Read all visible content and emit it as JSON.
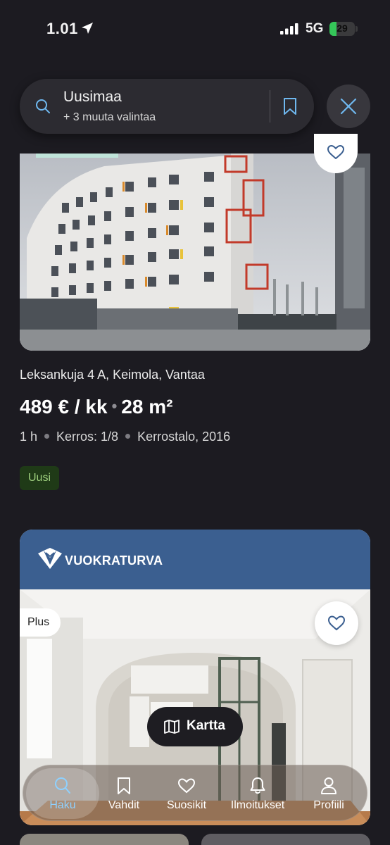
{
  "status_bar": {
    "time": "1.01",
    "network": "5G",
    "battery_level": "29",
    "battery_fraction": 0.29
  },
  "search": {
    "title": "Uusimaa",
    "subtitle": "+ 3 muuta valintaa"
  },
  "listing1": {
    "address": "Leksankuja 4 A, Keimola, Vantaa",
    "price": "489 € / kk",
    "area": "28  m²",
    "details": [
      "1 h",
      "Kerros: 1/8",
      "Kerrostalo, 2016"
    ],
    "badge": "Uusi"
  },
  "listing2": {
    "brand": "VUOKRATURVA",
    "badge": "Plus"
  },
  "map_button": {
    "label": "Kartta"
  },
  "nav": {
    "items": [
      {
        "label": "Haku",
        "icon": "search-icon"
      },
      {
        "label": "Vahdit",
        "icon": "bookmark-icon"
      },
      {
        "label": "Suosikit",
        "icon": "heart-icon"
      },
      {
        "label": "Ilmoitukset",
        "icon": "bell-icon"
      },
      {
        "label": "Profiili",
        "icon": "person-icon"
      }
    ]
  },
  "colors": {
    "background": "#1c1b21",
    "accent": "#8ed1ff",
    "new_badge": "#1f3a17",
    "brand_blue": "#3b5f90"
  }
}
